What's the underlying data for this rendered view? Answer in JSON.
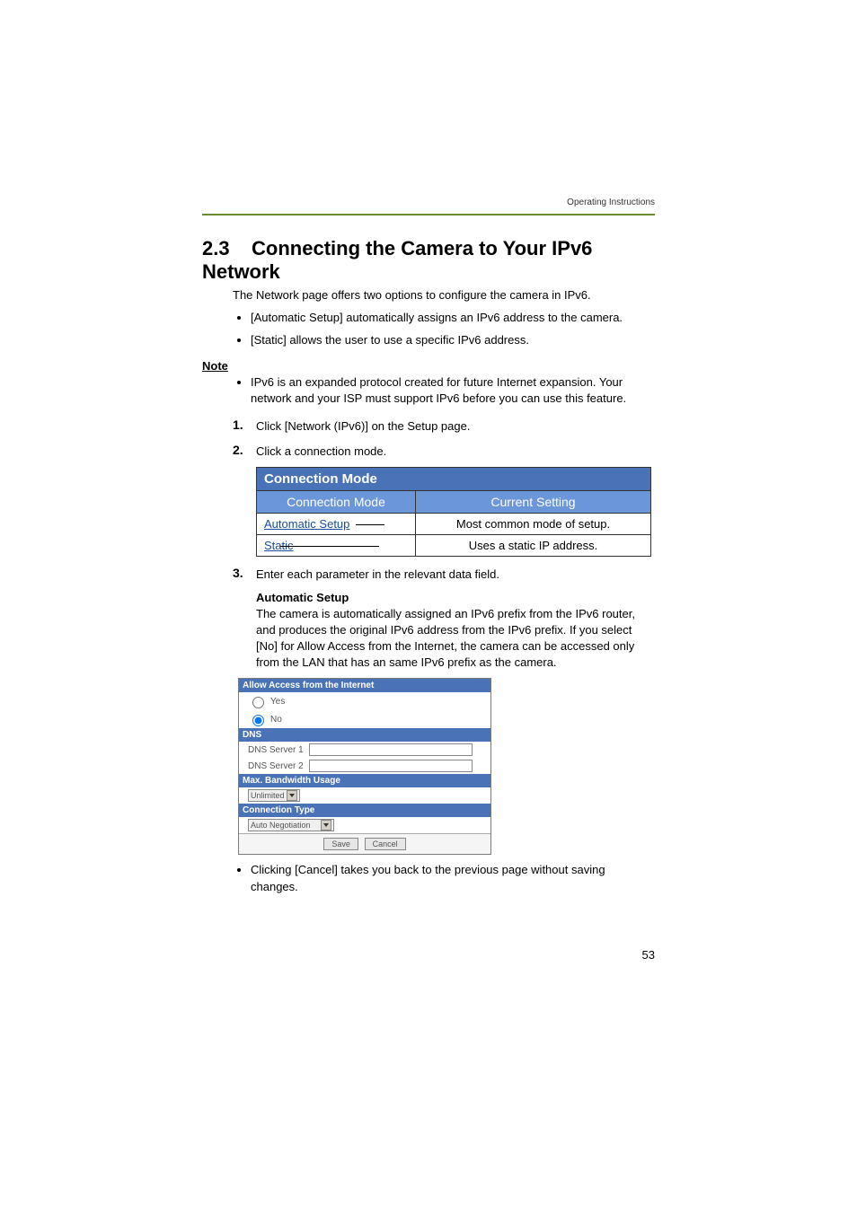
{
  "header": {
    "right": "Operating Instructions"
  },
  "section": {
    "number": "2.3",
    "title": "Connecting the Camera to Your IPv6 Network",
    "intro": "The Network page offers two options to configure the camera in IPv6.",
    "bullets": [
      "[Automatic Setup] automatically assigns an IPv6 address to the camera.",
      "[Static] allows the user to use a specific IPv6 address."
    ]
  },
  "note": {
    "label": "Note",
    "items": [
      "IPv6 is an expanded protocol created for future Internet expansion. Your network and your ISP must support IPv6 before you can use this feature."
    ]
  },
  "steps": [
    {
      "num": "1.",
      "text": "Click [Network (IPv6)] on the Setup page."
    },
    {
      "num": "2.",
      "text": "Click a connection mode."
    },
    {
      "num": "3.",
      "text": "Enter each parameter in the relevant data field."
    }
  ],
  "conn_table": {
    "title": "Connection Mode",
    "head_left": "Connection Mode",
    "head_right": "Current Setting",
    "rows": [
      {
        "label": "Automatic Setup",
        "desc": "Most common mode of setup."
      },
      {
        "label": "Static",
        "desc": "Uses a static IP address."
      }
    ]
  },
  "automatic": {
    "heading": "Automatic Setup",
    "body": "The camera is automatically assigned an IPv6 prefix from the IPv6 router, and produces the original IPv6 address from the IPv6 prefix. If you select [No] for Allow Access from the Internet, the camera can be accessed only from the LAN that has an same IPv6 prefix as the camera."
  },
  "form": {
    "access_hdr": "Allow Access from the Internet",
    "opt_yes": "Yes",
    "opt_no": "No",
    "dns_hdr": "DNS",
    "dns1": "DNS Server 1",
    "dns2": "DNS Server 2",
    "bw_hdr": "Max. Bandwidth Usage",
    "bw_val": "Unlimited",
    "ct_hdr": "Connection Type",
    "ct_val": "Auto Negotiation",
    "save": "Save",
    "cancel": "Cancel"
  },
  "closing": [
    "Clicking [Cancel] takes you back to the previous page without saving changes."
  ],
  "page_number": "53"
}
